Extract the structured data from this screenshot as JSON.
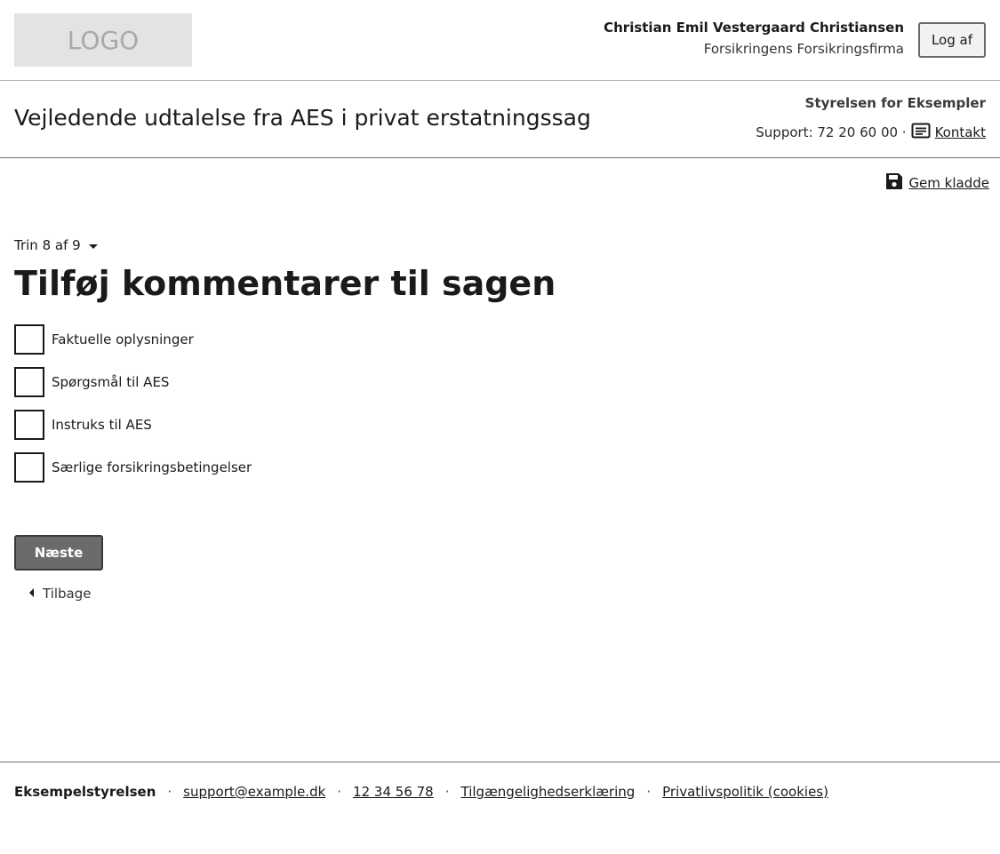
{
  "header": {
    "logo_text": "LOGO",
    "user_name": "Christian Emil Vestergaard Christiansen",
    "user_org": "Forsikringens Forsikringsfirma",
    "logout_label": "Log af"
  },
  "subheader": {
    "title": "Vejledende udtalelse fra AES i privat erstatningssag",
    "agency": "Styrelsen for Eksempler",
    "support_text": "Support: 72 20 60 00 ·",
    "contact_label": "Kontakt"
  },
  "toolbar": {
    "save_draft_label": "Gem kladde"
  },
  "main": {
    "step_label": "Trin 8 af 9",
    "heading": "Tilføj kommentarer til sagen",
    "options": [
      {
        "label": "Faktuelle oplysninger",
        "checked": false
      },
      {
        "label": "Spørgsmål til AES",
        "checked": false
      },
      {
        "label": "Instruks til AES",
        "checked": false
      },
      {
        "label": "Særlige forsikringsbetingelser",
        "checked": false
      }
    ],
    "next_label": "Næste",
    "back_label": "Tilbage"
  },
  "footer": {
    "brand": "Eksempelstyrelsen",
    "email": "support@example.dk",
    "phone": "12 34 56 78",
    "accessibility": "Tilgængelighedserklæring",
    "privacy": "Privatlivspolitik (cookies)",
    "separator": "·"
  },
  "colors": {
    "primary_button": "#6b6b6b",
    "logo_bg": "#e3e3e3",
    "text": "#1a1a1a"
  }
}
